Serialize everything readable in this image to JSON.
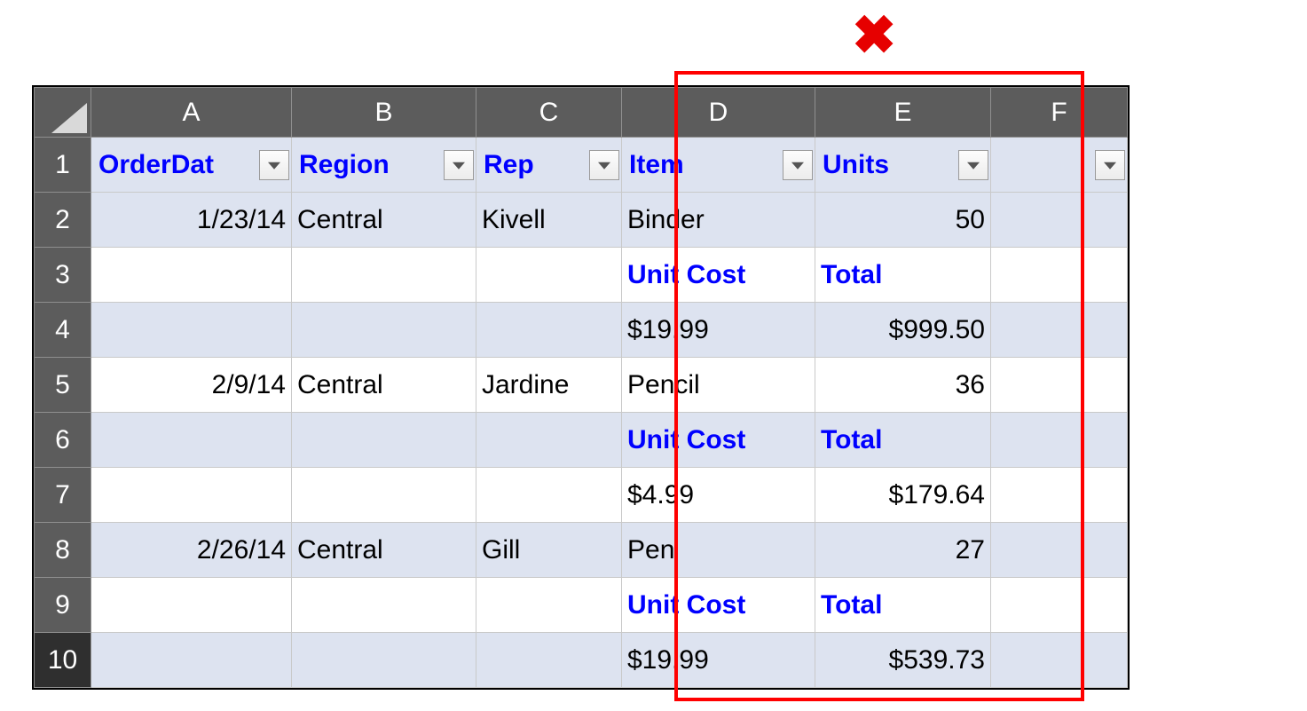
{
  "annotation": {
    "x_mark": "✖"
  },
  "columns": {
    "A": "A",
    "B": "B",
    "C": "C",
    "D": "D",
    "E": "E",
    "F": "F"
  },
  "rownums": {
    "r1": "1",
    "r2": "2",
    "r3": "3",
    "r4": "4",
    "r5": "5",
    "r6": "6",
    "r7": "7",
    "r8": "8",
    "r9": "9",
    "r10": "10"
  },
  "headers": {
    "A": "OrderDat",
    "B": "Region",
    "C": "Rep",
    "D": "Item",
    "E": "Units",
    "F": ""
  },
  "rows": {
    "r2": {
      "A": "1/23/14",
      "B": "Central",
      "C": "Kivell",
      "D": "Binder",
      "E": "50",
      "F": ""
    },
    "r3": {
      "A": "",
      "B": "",
      "C": "",
      "D": "Unit Cost",
      "E": "Total",
      "F": ""
    },
    "r4": {
      "A": "",
      "B": "",
      "C": "",
      "D": "$19.99",
      "E": "$999.50",
      "F": ""
    },
    "r5": {
      "A": "2/9/14",
      "B": "Central",
      "C": "Jardine",
      "D": "Pencil",
      "E": "36",
      "F": ""
    },
    "r6": {
      "A": "",
      "B": "",
      "C": "",
      "D": "Unit Cost",
      "E": "Total",
      "F": ""
    },
    "r7": {
      "A": "",
      "B": "",
      "C": "",
      "D": "$4.99",
      "E": "$179.64",
      "F": ""
    },
    "r8": {
      "A": "2/26/14",
      "B": "Central",
      "C": "Gill",
      "D": "Pen",
      "E": "27",
      "F": ""
    },
    "r9": {
      "A": "",
      "B": "",
      "C": "",
      "D": "Unit Cost",
      "E": "Total",
      "F": ""
    },
    "r10": {
      "A": "",
      "B": "",
      "C": "",
      "D": "$19.99",
      "E": "$539.73",
      "F": ""
    }
  }
}
